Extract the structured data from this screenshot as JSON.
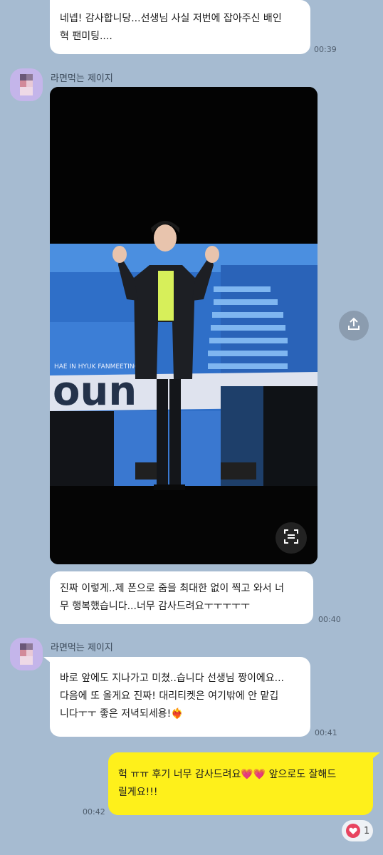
{
  "messages": [
    {
      "id": "m1",
      "side": "right-incoming",
      "lines": [
        "네넵! 감사합니당...선생님 사실 저번에 잡아주신 배인",
        "혁 팬미팅...."
      ],
      "time": "00:39"
    },
    {
      "id": "m2",
      "sender": "라면먹는 제이지",
      "type": "photo",
      "photo_texts": [
        "HAE IN HYUK FANMEETING",
        "oun"
      ]
    },
    {
      "id": "m3",
      "lines": [
        "진짜 이렇게..제 폰으로 줌을 최대한 없이 찍고 와서 너",
        "무 행복했습니다...너무 감사드려요ㅜㅜㅜㅜㅜ"
      ],
      "time": "00:40"
    },
    {
      "id": "m4",
      "sender": "라면먹는 제이지",
      "lines": [
        "바로 앞에도 지나가고 미쳤..습니다 선생님 짱이에요...",
        "다음에 또 올게요 진짜! 대리티켓은 여기밖에 안 맡깁",
        "니다ㅜㅜ 좋은 저녁되세용!❤️‍🔥"
      ],
      "time": "00:41"
    },
    {
      "id": "m5",
      "mine": true,
      "lines": [
        "헉 ㅠㅠ 후기 너무 감사드려요💗💗 앞으로도 잘해드",
        "릴게요!!!"
      ],
      "time": "00:42",
      "reaction": {
        "icon": "heart-icon",
        "count": "1"
      }
    }
  ],
  "icons": {
    "share": "share-icon",
    "scan": "scan-text-icon"
  },
  "colors": {
    "background": "#a6bbd1",
    "my_bubble": "#fef01b",
    "their_bubble": "#ffffff",
    "avatar": "#c4b5ea"
  }
}
